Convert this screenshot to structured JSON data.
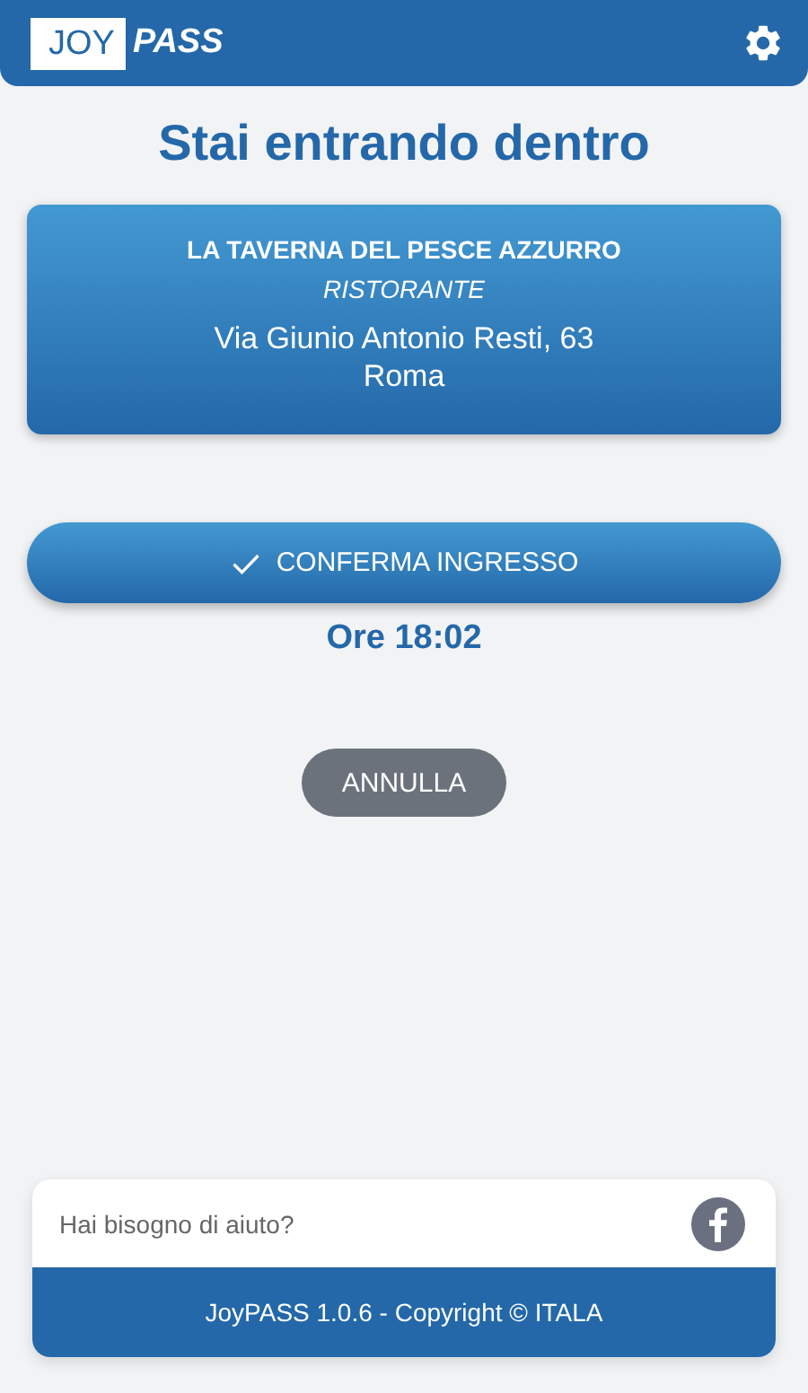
{
  "header": {
    "logo": {
      "left": "JOY",
      "right": "PASS"
    }
  },
  "title": "Stai entrando dentro",
  "venue": {
    "name": "LA TAVERNA DEL PESCE AZZURRO",
    "category": "RISTORANTE",
    "address": "Via Giunio Antonio Resti, 63",
    "city": "Roma"
  },
  "confirm_button": "CONFERMA INGRESSO",
  "time": "Ore 18:02",
  "cancel_button": "ANNULLA",
  "footer": {
    "help": "Hai bisogno di aiuto?",
    "copyright": "JoyPASS 1.0.6 - Copyright © ITALA"
  }
}
